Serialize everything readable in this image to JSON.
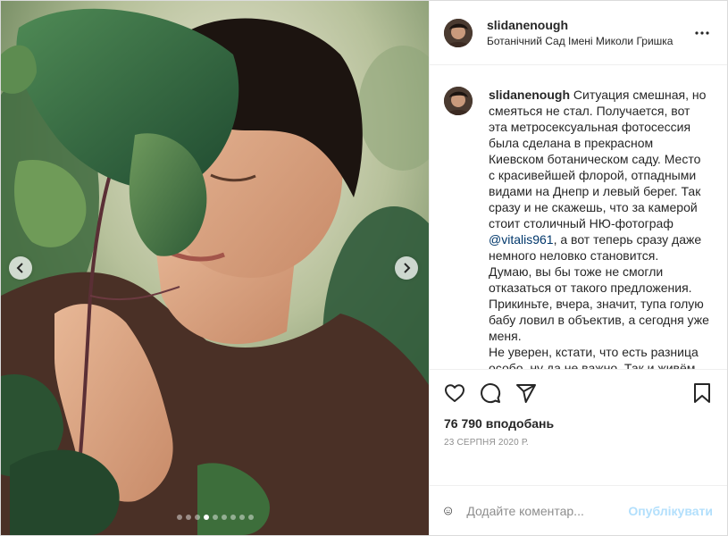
{
  "post": {
    "author": {
      "username": "slidanenough",
      "location": "Ботанічний Сад Імені Миколи Гришка"
    },
    "caption": {
      "username": "slidanenough",
      "text_before_mention": "Ситуация смешная, но смеяться не стал. Получается, вот эта метросексуальная фотосессия была сделана в прекрасном Киевском ботаническом саду. Место с красивейшей флорой, отпадными видами на Днепр и левый берег. Так сразу и не скажешь, что за камерой стоит столичный НЮ-фотограф",
      "mention": "@vitalis961",
      "text_after_mention": ", а вот теперь сразу даже немного неловко становится.",
      "paragraph_2": "Думаю, вы бы тоже не смогли отказаться от такого предложения. Прикиньте, вчера, значит, тупа голую бабу ловил в объектив, а сегодня уже меня.",
      "paragraph_3": "Не уверен, кстати, что есть разница особо, ну да не важно. Так и живём. Я трусы не снял, но вы можете попробовать обратиться с таким"
    },
    "likes": "76 790 вподобань",
    "date": "23 СЕРПНЯ 2020 Р.",
    "carousel": {
      "total_slides": 9,
      "active_slide": 4
    },
    "icons": {
      "like": "heart-icon",
      "comment": "comment-icon",
      "share": "share-icon",
      "save": "bookmark-icon",
      "more": "more-options-icon",
      "emoji": "emoji-icon",
      "prev": "chevron-left-icon",
      "next": "chevron-right-icon"
    }
  },
  "comment_box": {
    "placeholder": "Додайте коментар...",
    "publish_label": "Опублікувати"
  },
  "colors": {
    "link": "#00376b",
    "publish_disabled": "#b2dffc",
    "muted": "#8e8e8e",
    "border": "#efefef"
  }
}
